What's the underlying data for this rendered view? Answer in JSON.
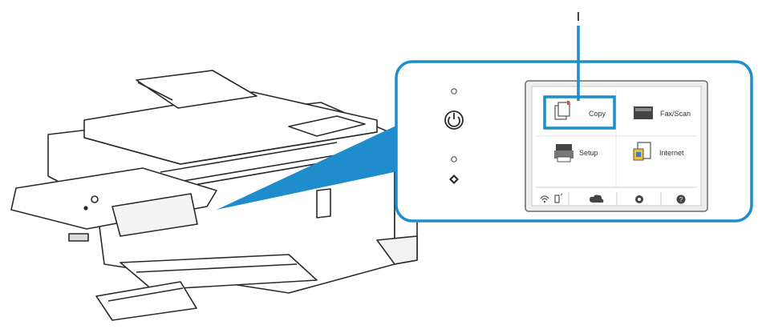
{
  "callout_label": "I",
  "panel": {
    "tiles": [
      {
        "label": "Copy",
        "icon": "copy-icon",
        "highlighted": true
      },
      {
        "label": "Fax/Scan",
        "icon": "scan-icon",
        "highlighted": false
      },
      {
        "label": "Setup",
        "icon": "printer-icon",
        "highlighted": false
      },
      {
        "label": "Internet",
        "icon": "photo-icon",
        "highlighted": false
      }
    ],
    "bottom_icons": [
      "wifi-icon",
      "cloud-icon",
      "settings-icon",
      "help-icon"
    ]
  },
  "colors": {
    "accent": "#1f8ccc",
    "line": "#2a2a2a",
    "panel_bg": "#eeeeee",
    "screen_bg": "#ffffff"
  }
}
